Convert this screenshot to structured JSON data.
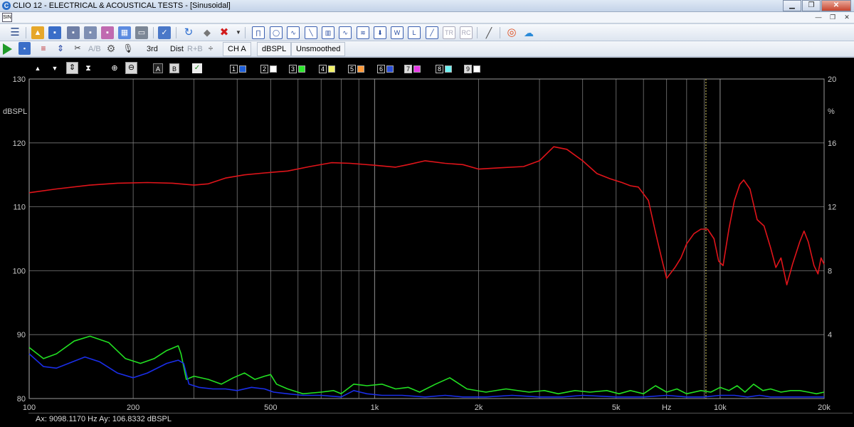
{
  "window": {
    "title": "CLIO 12 - ELECTRICAL & ACOUSTICAL TESTS - [Sinusoidal]",
    "app_icon_letter": "C",
    "doc_icon_letters": "SIN"
  },
  "toolbar2": {
    "third_label": "3rd",
    "dist_label": "Dist",
    "rb_label": "R+B",
    "ab_label": "A/B",
    "channel_label": "CH A",
    "unit_label": "dBSPL",
    "smoothing_label": "Unsmoothed"
  },
  "plot_toolbar": {
    "a_label": "A",
    "b_label": "B",
    "curves": [
      {
        "num": "1",
        "color": "#1f5fd8"
      },
      {
        "num": "2",
        "color": "#ffffff"
      },
      {
        "num": "3",
        "color": "#2ee82e"
      },
      {
        "num": "4",
        "color": "#f2f26a"
      },
      {
        "num": "5",
        "color": "#ff9a3a"
      },
      {
        "num": "6",
        "color": "#2a4fd8"
      },
      {
        "num": "7",
        "color": "#e83ae8"
      },
      {
        "num": "8",
        "color": "#6ef2f2"
      },
      {
        "num": "9",
        "color": "#ffffff"
      }
    ]
  },
  "status_text": "Ax: 9098.1170 Hz  Ay: 106.8332 dBSPL",
  "chart_data": {
    "type": "line",
    "xscale": "log",
    "xlim": [
      100,
      20000
    ],
    "ylim": [
      80,
      130
    ],
    "y2lim": [
      0,
      20
    ],
    "xticks": [
      {
        "v": 100,
        "label": "100"
      },
      {
        "v": 200,
        "label": "200"
      },
      {
        "v": 500,
        "label": "500"
      },
      {
        "v": 1000,
        "label": "1k"
      },
      {
        "v": 2000,
        "label": "2k"
      },
      {
        "v": 5000,
        "label": "5k"
      },
      {
        "v": 7000,
        "label": "Hz"
      },
      {
        "v": 10000,
        "label": "10k"
      },
      {
        "v": 20000,
        "label": "20k"
      }
    ],
    "yticks": [
      80,
      90,
      100,
      110,
      120,
      130
    ],
    "y2ticks": [
      4,
      8,
      12,
      16,
      20
    ],
    "ylabel": "dBSPL",
    "y2label": "%",
    "cursor_x": 9098.117,
    "grid": true,
    "colors": {
      "red": "#e0141a",
      "green": "#22e022",
      "blue": "#1a2ee8",
      "grid": "#7a7a7a",
      "cursor": "#e8d96a",
      "axis_text": "#c8c8c8"
    },
    "series": [
      {
        "color": "red",
        "axis": "left",
        "points": [
          [
            100,
            112.2
          ],
          [
            120,
            112.8
          ],
          [
            150,
            113.4
          ],
          [
            180,
            113.7
          ],
          [
            220,
            113.8
          ],
          [
            260,
            113.7
          ],
          [
            300,
            113.4
          ],
          [
            330,
            113.6
          ],
          [
            370,
            114.5
          ],
          [
            420,
            115.0
          ],
          [
            480,
            115.3
          ],
          [
            560,
            115.6
          ],
          [
            650,
            116.3
          ],
          [
            750,
            116.9
          ],
          [
            850,
            116.8
          ],
          [
            1000,
            116.5
          ],
          [
            1150,
            116.2
          ],
          [
            1250,
            116.6
          ],
          [
            1400,
            117.2
          ],
          [
            1600,
            116.8
          ],
          [
            1800,
            116.6
          ],
          [
            2000,
            115.9
          ],
          [
            2300,
            116.1
          ],
          [
            2700,
            116.3
          ],
          [
            3000,
            117.2
          ],
          [
            3300,
            119.4
          ],
          [
            3600,
            119.0
          ],
          [
            4000,
            117.2
          ],
          [
            4400,
            115.2
          ],
          [
            4800,
            114.4
          ],
          [
            5200,
            113.8
          ],
          [
            5500,
            113.3
          ],
          [
            5800,
            113.1
          ],
          [
            6200,
            111.0
          ],
          [
            6500,
            106.0
          ],
          [
            6800,
            101.5
          ],
          [
            7000,
            98.8
          ],
          [
            7400,
            100.5
          ],
          [
            7700,
            102.0
          ],
          [
            8000,
            104.2
          ],
          [
            8400,
            105.8
          ],
          [
            8800,
            106.5
          ],
          [
            9200,
            106.5
          ],
          [
            9600,
            105.0
          ],
          [
            9900,
            101.5
          ],
          [
            10200,
            100.8
          ],
          [
            10600,
            106.5
          ],
          [
            11000,
            111.0
          ],
          [
            11400,
            113.5
          ],
          [
            11700,
            114.2
          ],
          [
            12200,
            112.8
          ],
          [
            12800,
            108.0
          ],
          [
            13400,
            107.0
          ],
          [
            14000,
            103.6
          ],
          [
            14500,
            100.5
          ],
          [
            15000,
            102.0
          ],
          [
            15600,
            97.8
          ],
          [
            16200,
            101.0
          ],
          [
            17000,
            104.5
          ],
          [
            17500,
            106.2
          ],
          [
            18000,
            104.5
          ],
          [
            18700,
            100.8
          ],
          [
            19200,
            99.5
          ],
          [
            19600,
            102.0
          ],
          [
            20000,
            101.0
          ]
        ]
      },
      {
        "color": "green",
        "axis": "right",
        "points": [
          [
            100,
            3.2
          ],
          [
            110,
            2.5
          ],
          [
            120,
            2.8
          ],
          [
            135,
            3.6
          ],
          [
            150,
            3.9
          ],
          [
            170,
            3.5
          ],
          [
            190,
            2.5
          ],
          [
            210,
            2.2
          ],
          [
            230,
            2.5
          ],
          [
            250,
            3.0
          ],
          [
            270,
            3.3
          ],
          [
            275,
            2.8
          ],
          [
            285,
            1.2
          ],
          [
            300,
            1.4
          ],
          [
            330,
            1.2
          ],
          [
            360,
            0.9
          ],
          [
            390,
            1.3
          ],
          [
            420,
            1.6
          ],
          [
            450,
            1.2
          ],
          [
            480,
            1.4
          ],
          [
            500,
            1.5
          ],
          [
            520,
            0.9
          ],
          [
            560,
            0.6
          ],
          [
            620,
            0.3
          ],
          [
            700,
            0.4
          ],
          [
            760,
            0.5
          ],
          [
            800,
            0.3
          ],
          [
            870,
            0.9
          ],
          [
            950,
            0.8
          ],
          [
            1050,
            0.9
          ],
          [
            1150,
            0.6
          ],
          [
            1250,
            0.7
          ],
          [
            1350,
            0.4
          ],
          [
            1500,
            0.9
          ],
          [
            1650,
            1.3
          ],
          [
            1850,
            0.6
          ],
          [
            2100,
            0.4
          ],
          [
            2400,
            0.6
          ],
          [
            2800,
            0.4
          ],
          [
            3100,
            0.5
          ],
          [
            3400,
            0.3
          ],
          [
            3800,
            0.5
          ],
          [
            4200,
            0.4
          ],
          [
            4700,
            0.5
          ],
          [
            5100,
            0.3
          ],
          [
            5500,
            0.5
          ],
          [
            6000,
            0.3
          ],
          [
            6500,
            0.8
          ],
          [
            7000,
            0.4
          ],
          [
            7500,
            0.6
          ],
          [
            8000,
            0.3
          ],
          [
            8800,
            0.5
          ],
          [
            9400,
            0.4
          ],
          [
            10000,
            0.7
          ],
          [
            10600,
            0.5
          ],
          [
            11200,
            0.8
          ],
          [
            11800,
            0.4
          ],
          [
            12500,
            0.9
          ],
          [
            13300,
            0.5
          ],
          [
            14000,
            0.6
          ],
          [
            15000,
            0.4
          ],
          [
            16000,
            0.5
          ],
          [
            17000,
            0.5
          ],
          [
            18000,
            0.4
          ],
          [
            19000,
            0.3
          ],
          [
            20000,
            0.4
          ]
        ]
      },
      {
        "color": "blue",
        "axis": "right",
        "points": [
          [
            100,
            2.8
          ],
          [
            110,
            2.0
          ],
          [
            120,
            1.9
          ],
          [
            130,
            2.2
          ],
          [
            145,
            2.6
          ],
          [
            160,
            2.3
          ],
          [
            180,
            1.6
          ],
          [
            200,
            1.3
          ],
          [
            220,
            1.6
          ],
          [
            250,
            2.2
          ],
          [
            270,
            2.4
          ],
          [
            280,
            2.2
          ],
          [
            290,
            0.9
          ],
          [
            310,
            0.7
          ],
          [
            340,
            0.6
          ],
          [
            370,
            0.6
          ],
          [
            400,
            0.5
          ],
          [
            440,
            0.7
          ],
          [
            480,
            0.6
          ],
          [
            510,
            0.4
          ],
          [
            560,
            0.3
          ],
          [
            620,
            0.2
          ],
          [
            700,
            0.2
          ],
          [
            800,
            0.1
          ],
          [
            870,
            0.5
          ],
          [
            950,
            0.3
          ],
          [
            1050,
            0.2
          ],
          [
            1200,
            0.2
          ],
          [
            1400,
            0.1
          ],
          [
            1600,
            0.2
          ],
          [
            1800,
            0.1
          ],
          [
            2100,
            0.1
          ],
          [
            2500,
            0.2
          ],
          [
            3000,
            0.1
          ],
          [
            3500,
            0.1
          ],
          [
            4000,
            0.2
          ],
          [
            5000,
            0.1
          ],
          [
            6000,
            0.1
          ],
          [
            7000,
            0.2
          ],
          [
            8000,
            0.1
          ],
          [
            9000,
            0.1
          ],
          [
            10000,
            0.2
          ],
          [
            11000,
            0.2
          ],
          [
            12000,
            0.1
          ],
          [
            13000,
            0.2
          ],
          [
            14000,
            0.1
          ],
          [
            15000,
            0.1
          ],
          [
            16000,
            0.1
          ],
          [
            18000,
            0.1
          ],
          [
            20000,
            0.1
          ]
        ]
      }
    ]
  }
}
